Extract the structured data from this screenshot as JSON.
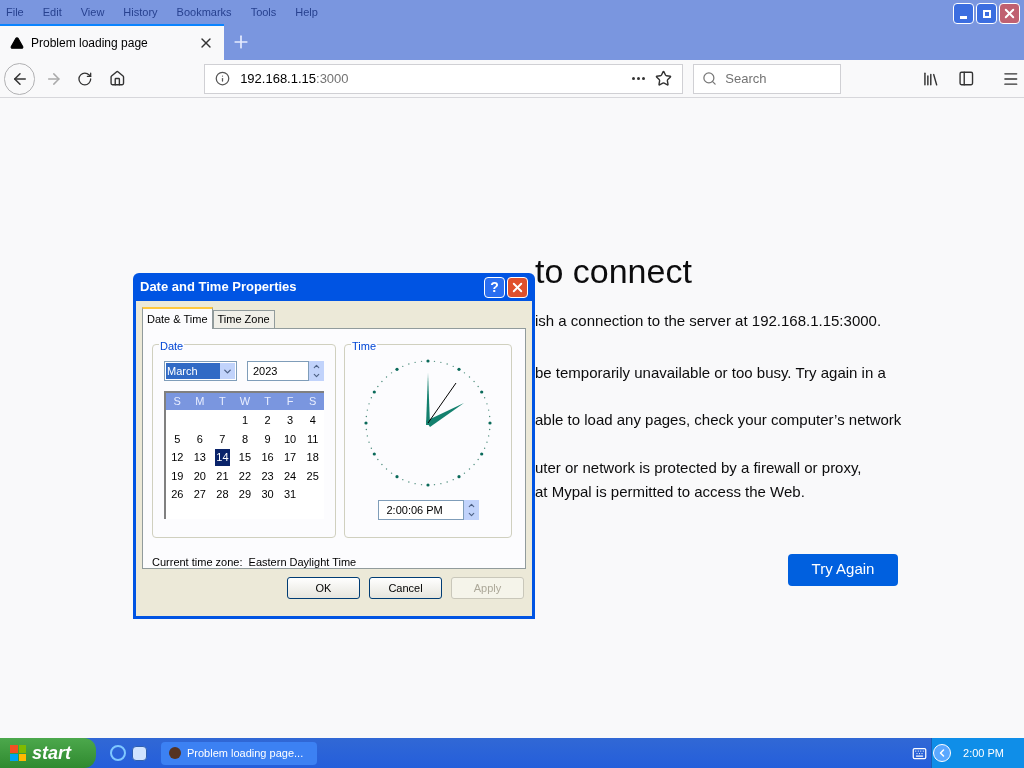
{
  "menu_bar": [
    "File",
    "Edit",
    "View",
    "History",
    "Bookmarks",
    "Tools",
    "Help"
  ],
  "tabs": [
    {
      "label": "Problem loading page",
      "selected": true
    }
  ],
  "address_bar": {
    "host": "192.168.1.15",
    "port": ":3000"
  },
  "search": {
    "placeholder": "Search"
  },
  "error_page": {
    "title": "to connect",
    "lines": [
      "ish a connection to the server at 192.168.1.15:3000.",
      "be temporarily unavailable or too busy. Try again in a",
      "able to load any pages, check your computer’s network",
      "uter or network is protected by a firewall or proxy,",
      "at Mypal is permitted to access the Web."
    ],
    "button": "Try Again"
  },
  "dialog": {
    "title": "Date and Time Properties",
    "help_glyph": "?",
    "tabs": [
      {
        "label": "Date & Time",
        "selected": true
      },
      {
        "label": "Time Zone",
        "selected": false
      }
    ],
    "date_group": "Date",
    "month": "March",
    "year": "2023",
    "weekdays": [
      "S",
      "M",
      "T",
      "W",
      "T",
      "F",
      "S"
    ],
    "weeks": [
      [
        {
          "day": "1",
          "selected": false
        },
        {
          "day": "2",
          "selected": false
        },
        {
          "day": "3",
          "selected": false
        },
        {
          "day": "4",
          "selected": false
        }
      ],
      [
        {
          "day": "5",
          "selected": false
        },
        {
          "day": "6",
          "selected": false
        },
        {
          "day": "7",
          "selected": false
        },
        {
          "day": "8",
          "selected": false
        },
        {
          "day": "9",
          "selected": false
        },
        {
          "day": "10",
          "selected": false
        },
        {
          "day": "11",
          "selected": false
        }
      ],
      [
        {
          "day": "12",
          "selected": false
        },
        {
          "day": "13",
          "selected": false
        },
        {
          "day": "14",
          "selected": true
        },
        {
          "day": "15",
          "selected": false
        },
        {
          "day": "16",
          "selected": false
        },
        {
          "day": "17",
          "selected": false
        },
        {
          "day": "18",
          "selected": false
        }
      ],
      [
        {
          "day": "19",
          "selected": false
        },
        {
          "day": "20",
          "selected": false
        },
        {
          "day": "21",
          "selected": false
        },
        {
          "day": "22",
          "selected": false
        },
        {
          "day": "23",
          "selected": false
        },
        {
          "day": "24",
          "selected": false
        },
        {
          "day": "25",
          "selected": false
        }
      ],
      [
        {
          "day": "26",
          "selected": false
        },
        {
          "day": "27",
          "selected": false
        },
        {
          "day": "28",
          "selected": false
        },
        {
          "day": "29",
          "selected": false
        },
        {
          "day": "30",
          "selected": false
        },
        {
          "day": "31",
          "selected": false
        }
      ]
    ],
    "time_group": "Time",
    "time": "2:00:06 PM",
    "timezone_label": "Current time zone:  Eastern Daylight Time",
    "buttons": [
      {
        "label": "OK",
        "disabled": false
      },
      {
        "label": "Cancel",
        "disabled": false
      },
      {
        "label": "Apply",
        "disabled": true
      }
    ]
  },
  "taskbar": {
    "start": "start",
    "tasks": [
      {
        "label": "Problem loading page...",
        "selected": false
      }
    ],
    "clock": "2:00 PM"
  }
}
